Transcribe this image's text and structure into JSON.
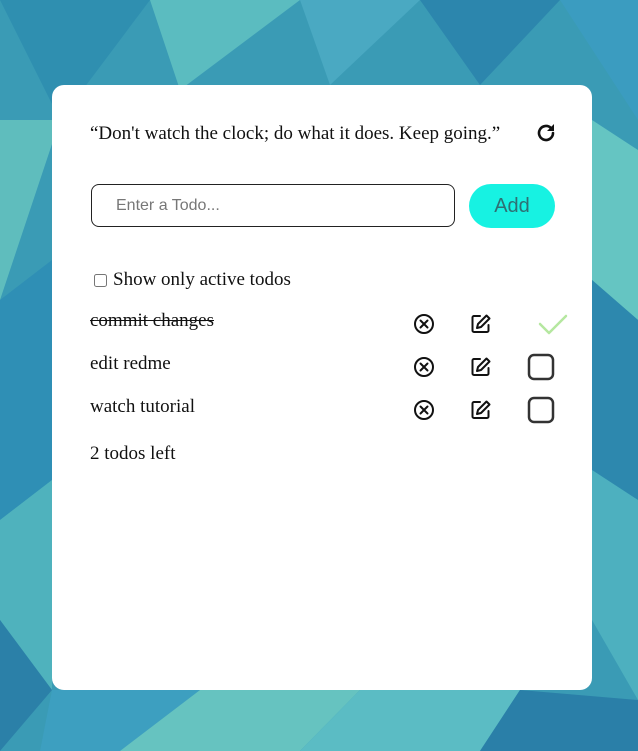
{
  "quote": "“Don't watch the clock; do what it does. Keep going.”",
  "input": {
    "placeholder": "Enter a Todo...",
    "value": ""
  },
  "add_label": "Add",
  "filter_label": "Show only active todos",
  "filter_checked": false,
  "todos": [
    {
      "text": "commit changes",
      "completed": true
    },
    {
      "text": "edit redme",
      "completed": false
    },
    {
      "text": "watch tutorial",
      "completed": false
    }
  ],
  "remaining_text": "2 todos left",
  "colors": {
    "add_button": "#17f2e2",
    "completed_check": "#b5e7a0",
    "card": "#ffffff"
  },
  "icons": {
    "refresh": "refresh-icon",
    "delete": "close-circle-icon",
    "edit": "edit-icon",
    "unchecked": "checkbox-icon",
    "checked": "checkmark-icon"
  }
}
